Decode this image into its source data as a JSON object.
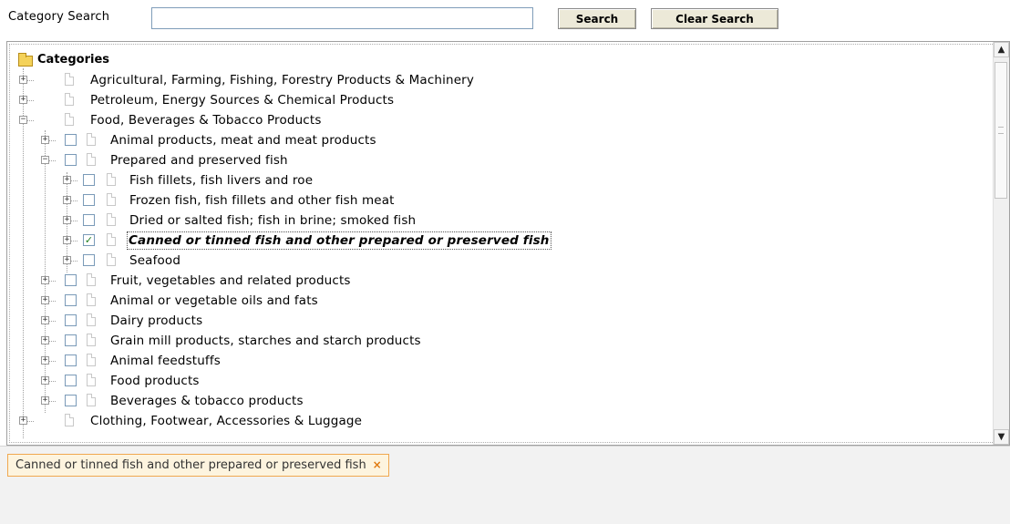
{
  "search": {
    "label": "Category Search",
    "value": "",
    "search_button": "Search",
    "clear_button": "Clear Search"
  },
  "tree": {
    "root": "Categories",
    "top_level": [
      {
        "label": "Agricultural, Farming, Fishing, Forestry Products & Machinery",
        "expanded": false
      },
      {
        "label": "Petroleum, Energy Sources & Chemical Products",
        "expanded": false
      },
      {
        "label": "Food, Beverages & Tobacco Products",
        "expanded": true
      },
      {
        "label": "Clothing, Footwear, Accessories & Luggage",
        "expanded": false
      }
    ],
    "food_children": [
      {
        "label": "Animal products, meat and meat products",
        "checked": false
      },
      {
        "label": "Prepared and preserved fish",
        "checked": false,
        "expanded": true
      },
      {
        "label": "Fruit, vegetables and related products",
        "checked": false
      },
      {
        "label": "Animal or vegetable oils and fats",
        "checked": false
      },
      {
        "label": "Dairy products",
        "checked": false
      },
      {
        "label": "Grain mill products, starches and starch products",
        "checked": false
      },
      {
        "label": "Animal feedstuffs",
        "checked": false
      },
      {
        "label": "Food products",
        "checked": false
      },
      {
        "label": "Beverages & tobacco products",
        "checked": false
      }
    ],
    "fish_children": [
      {
        "label": "Fish fillets, fish livers and roe",
        "checked": false
      },
      {
        "label": "Frozen fish, fish fillets and other fish meat",
        "checked": false
      },
      {
        "label": "Dried or salted fish; fish in brine; smoked fish",
        "checked": false
      },
      {
        "label": "Canned or tinned fish and other prepared or preserved fish",
        "checked": true,
        "selected": true
      },
      {
        "label": "Seafood",
        "checked": false
      }
    ]
  },
  "selected_tags": [
    {
      "label": "Canned or tinned fish and other prepared or preserved fish",
      "remove_icon": "close-icon"
    }
  ],
  "colors": {
    "check": "#1e7d1e",
    "tag_border": "#f0a850",
    "tag_bg": "#fdf4df",
    "tag_close": "#e07a10"
  }
}
